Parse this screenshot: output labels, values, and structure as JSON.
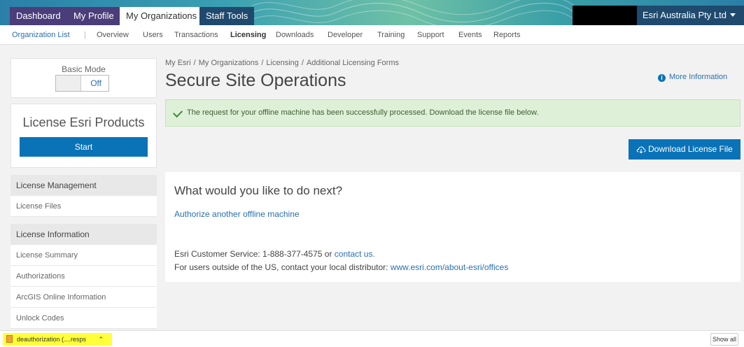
{
  "topnav": {
    "tabs": [
      {
        "label": "Dashboard"
      },
      {
        "label": "My Profile"
      },
      {
        "label": "My Organizations"
      },
      {
        "label": "Staff Tools"
      }
    ],
    "org_name": "Esri Australia Pty Ltd"
  },
  "subnav": {
    "items": [
      "Organization List",
      "Overview",
      "Users",
      "Transactions",
      "Licensing",
      "Downloads",
      "Developer",
      "Training",
      "Support",
      "Events",
      "Reports"
    ],
    "active": "Licensing"
  },
  "sidebar": {
    "basic_mode_label": "Basic Mode",
    "basic_mode_value": "Off",
    "license_card_title": "License Esri Products",
    "start_button": "Start",
    "sections": [
      {
        "heading": "License Management",
        "items": [
          "License Files"
        ]
      },
      {
        "heading": "License Information",
        "items": [
          "License Summary",
          "Authorizations",
          "ArcGIS Online Information",
          "Unlock Codes"
        ]
      }
    ]
  },
  "main": {
    "breadcrumb": [
      "My Esri",
      "My Organizations",
      "Licensing",
      "Additional Licensing Forms"
    ],
    "title": "Secure Site Operations",
    "more_info": "More Information",
    "success_message": "The request for your offline machine has been successfully processed. Download the license file below.",
    "download_button": "Download License File",
    "next": {
      "title": "What would you like to do next?",
      "link": "Authorize another offline machine",
      "cs_prefix": "Esri Customer Service: 1-888-377-4575 or ",
      "cs_link": "contact us.",
      "intl_prefix": "For users outside of the US, contact your local distributor: ",
      "intl_link": "www.esri.com/about-esri/offices"
    }
  },
  "download_bar": {
    "file_label": "deauthorization (....resps",
    "show_all": "Show all"
  },
  "colors": {
    "primary": "#0a73b8",
    "link": "#2a6fb0",
    "success_bg": "#dff0d8",
    "nav_dark": "#4a3d7a",
    "staff_tab": "#1f4a6e"
  }
}
